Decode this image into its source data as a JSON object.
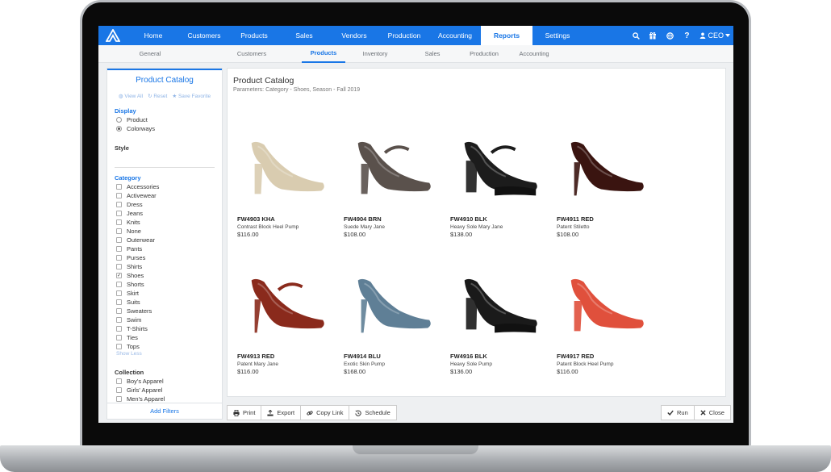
{
  "topnav": {
    "items": [
      "Home",
      "Customers",
      "Products",
      "Sales",
      "Vendors",
      "Production",
      "Accounting",
      "Reports",
      "Settings"
    ],
    "active_index": 7,
    "user": "CEO"
  },
  "subnav": {
    "items": [
      "General",
      "Customers",
      "Products",
      "Inventory",
      "Sales",
      "Production",
      "Accounting"
    ],
    "active_index": 2
  },
  "sidebar": {
    "title": "Product Catalog",
    "actions": [
      "View All",
      "Reset",
      "Save Favorite"
    ],
    "display_heading": "Display",
    "display_options": [
      {
        "label": "Product",
        "selected": false
      },
      {
        "label": "Colorways",
        "selected": true
      }
    ],
    "style_heading": "Style",
    "category_heading": "Category",
    "categories": [
      {
        "label": "Accessories",
        "checked": false
      },
      {
        "label": "Activewear",
        "checked": false
      },
      {
        "label": "Dress",
        "checked": false
      },
      {
        "label": "Jeans",
        "checked": false
      },
      {
        "label": "Knits",
        "checked": false
      },
      {
        "label": "None",
        "checked": false
      },
      {
        "label": "Outerwear",
        "checked": false
      },
      {
        "label": "Pants",
        "checked": false
      },
      {
        "label": "Purses",
        "checked": false
      },
      {
        "label": "Shirts",
        "checked": false
      },
      {
        "label": "Shoes",
        "checked": true
      },
      {
        "label": "Shorts",
        "checked": false
      },
      {
        "label": "Skirt",
        "checked": false
      },
      {
        "label": "Suits",
        "checked": false
      },
      {
        "label": "Sweaters",
        "checked": false
      },
      {
        "label": "Swim",
        "checked": false
      },
      {
        "label": "T-Shirts",
        "checked": false
      },
      {
        "label": "Ties",
        "checked": false
      },
      {
        "label": "Tops",
        "checked": false
      }
    ],
    "show_less": "Show Less",
    "collection_heading": "Collection",
    "collections": [
      {
        "label": "Boy's Apparel",
        "checked": false
      },
      {
        "label": "Girls' Apparel",
        "checked": false
      },
      {
        "label": "Men's Apparel",
        "checked": false
      }
    ],
    "add_filters": "Add Filters"
  },
  "main": {
    "title": "Product Catalog",
    "params": "Parameters: Category - Shoes, Season - Fall 2019",
    "products": [
      {
        "sku": "FW4903 KHA",
        "desc": "Contrast Block Heel Pump",
        "price": "$116.00",
        "color": "#d9ccb0"
      },
      {
        "sku": "FW4904 BRN",
        "desc": "Suede Mary Jane",
        "price": "$108.00",
        "color": "#5a514c"
      },
      {
        "sku": "FW4910 BLK",
        "desc": "Heavy Sole Mary Jane",
        "price": "$138.00",
        "color": "#1c1c1c"
      },
      {
        "sku": "FW4911 RED",
        "desc": "Patent Stiletto",
        "price": "$108.00",
        "color": "#3a1410"
      },
      {
        "sku": "FW4913 RED",
        "desc": "Patent Mary Jane",
        "price": "$116.00",
        "color": "#8a2a1c"
      },
      {
        "sku": "FW4914 BLU",
        "desc": "Exotic Skin Pump",
        "price": "$168.00",
        "color": "#5f7f96"
      },
      {
        "sku": "FW4916 BLK",
        "desc": "Heavy Sole Pump",
        "price": "$136.00",
        "color": "#1a1a1a"
      },
      {
        "sku": "FW4917 RED",
        "desc": "Patent Block Heel Pump",
        "price": "$116.00",
        "color": "#e0503c"
      }
    ]
  },
  "toolbar": {
    "print": "Print",
    "export": "Export",
    "copy_link": "Copy Link",
    "schedule": "Schedule",
    "run": "Run",
    "close": "Close"
  }
}
